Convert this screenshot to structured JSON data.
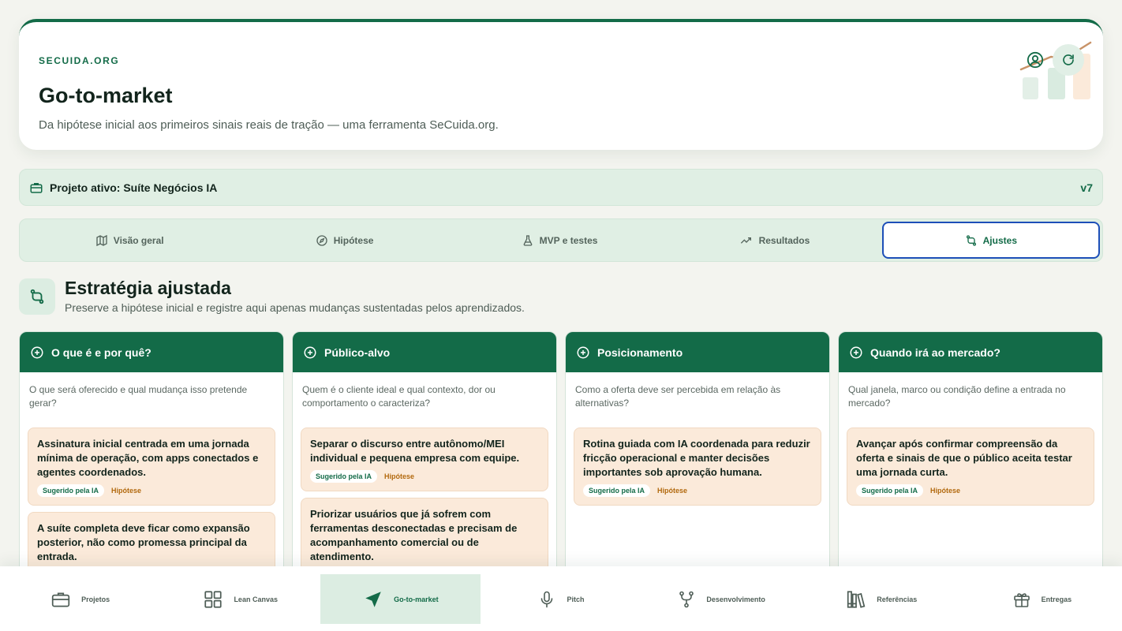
{
  "header": {
    "brand": "SECUIDA.ORG",
    "title": "Go-to-market",
    "subtitle": "Da hipótese inicial aos primeiros sinais reais de tração — uma ferramenta SeCuida.org.",
    "user_icon": "user-circle-icon",
    "refresh_icon": "refresh-icon"
  },
  "project": {
    "label": "Projeto ativo: Suíte Negócios IA",
    "version": "v7",
    "icon": "briefcase-icon"
  },
  "tabs": [
    {
      "label": "Visão geral",
      "icon": "map-icon"
    },
    {
      "label": "Hipótese",
      "icon": "compass-icon"
    },
    {
      "label": "MVP e testes",
      "icon": "flask-icon"
    },
    {
      "label": "Resultados",
      "icon": "trend-icon"
    },
    {
      "label": "Ajustes",
      "icon": "swap-icon",
      "active": true
    }
  ],
  "section": {
    "title": "Estratégia ajustada",
    "subtitle": "Preserve a hipótese inicial e registre aqui apenas mudanças sustentadas pelos aprendizados."
  },
  "tags": {
    "ai": "Sugerido pela IA",
    "hypothesis": "Hipótese"
  },
  "columns": [
    {
      "title": "O que é e por quê?",
      "question": "O que será oferecido e qual mudança isso pretende gerar?",
      "cards": [
        {
          "text": "Assinatura inicial centrada em uma jornada mínima de operação, com apps conectados e agentes coordenados.",
          "tagged": true
        },
        {
          "text": "A suíte completa deve ficar como expansão posterior, não como promessa principal da entrada.",
          "tagged": false
        }
      ]
    },
    {
      "title": "Público-alvo",
      "question": "Quem é o cliente ideal e qual contexto, dor ou comportamento o caracteriza?",
      "cards": [
        {
          "text": "Separar o discurso entre autônomo/MEI individual e pequena empresa com equipe.",
          "tagged": true
        },
        {
          "text": "Priorizar usuários que já sofrem com ferramentas desconectadas e precisam de acompanhamento comercial ou de atendimento.",
          "tagged": false
        }
      ]
    },
    {
      "title": "Posicionamento",
      "question": "Como a oferta deve ser percebida em relação às alternativas?",
      "cards": [
        {
          "text": "Rotina guiada com IA coordenada para reduzir fricção operacional e manter decisões importantes sob aprovação humana.",
          "tagged": true
        }
      ]
    },
    {
      "title": "Quando irá ao mercado?",
      "question": "Qual janela, marco ou condição define a entrada no mercado?",
      "cards": [
        {
          "text": "Avançar após confirmar compreensão da oferta e sinais de que o público aceita testar uma jornada curta.",
          "tagged": true
        }
      ]
    }
  ],
  "nav": [
    {
      "label": "Projetos",
      "icon": "briefcase-icon"
    },
    {
      "label": "Lean Canvas",
      "icon": "grid-icon"
    },
    {
      "label": "Go-to-market",
      "icon": "navigation-icon",
      "active": true
    },
    {
      "label": "Pitch",
      "icon": "microphone-icon"
    },
    {
      "label": "Desenvolvimento",
      "icon": "branch-icon"
    },
    {
      "label": "Referências",
      "icon": "library-icon"
    },
    {
      "label": "Entregas",
      "icon": "gift-icon"
    }
  ],
  "colors": {
    "primary": "#136b48",
    "light_green": "#e0efe4",
    "card": "#fbeada",
    "active_tab_border": "#1d4fb8",
    "hypothesis_tag": "#b2690e"
  }
}
